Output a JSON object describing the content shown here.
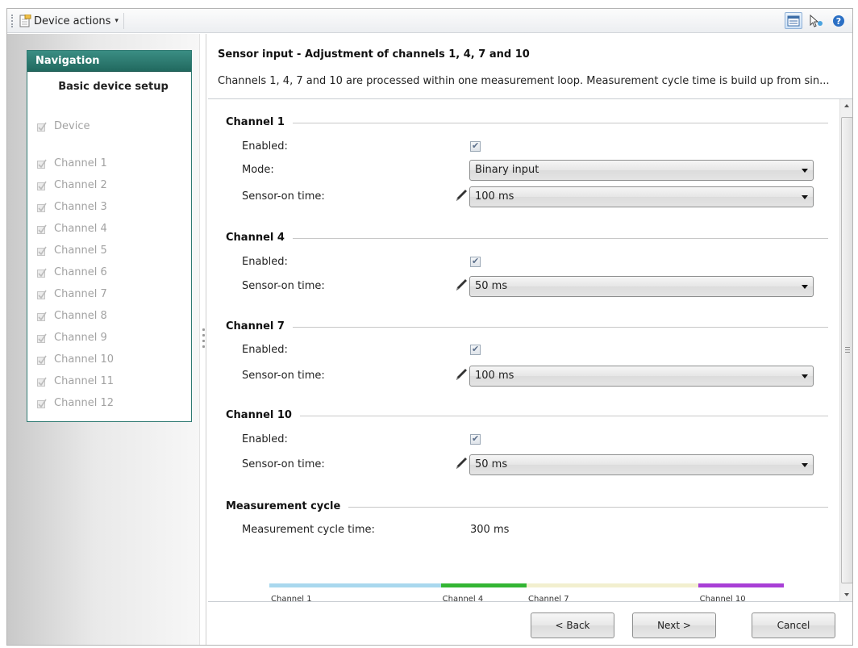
{
  "toolbar": {
    "device_actions_label": "Device actions",
    "icons": [
      "grip-icon",
      "document-icon",
      "dropdown-caret-icon",
      "layout-view-icon",
      "pointer-help-icon",
      "help-icon"
    ]
  },
  "navigation": {
    "header": "Navigation",
    "title": "Basic device setup",
    "items": [
      {
        "label": "Device"
      },
      {
        "label": "Channel 1"
      },
      {
        "label": "Channel 2"
      },
      {
        "label": "Channel 3"
      },
      {
        "label": "Channel 4"
      },
      {
        "label": "Channel 5"
      },
      {
        "label": "Channel 6"
      },
      {
        "label": "Channel 7"
      },
      {
        "label": "Channel 8"
      },
      {
        "label": "Channel 9"
      },
      {
        "label": "Channel 10"
      },
      {
        "label": "Channel 11"
      },
      {
        "label": "Channel 12"
      }
    ]
  },
  "page": {
    "title": "Sensor input - Adjustment of channels 1, 4, 7 and 10",
    "description": "Channels 1, 4, 7 and 10 are processed within one measurement loop. Measurement cycle time is build up from sin..."
  },
  "sections": [
    {
      "title": "Channel 1",
      "enabled_label": "Enabled:",
      "enabled": true,
      "mode_label": "Mode:",
      "mode_value": "Binary input",
      "sensor_label": "Sensor-on time:",
      "sensor_value": "100 ms"
    },
    {
      "title": "Channel 4",
      "enabled_label": "Enabled:",
      "enabled": true,
      "sensor_label": "Sensor-on time:",
      "sensor_value": "50 ms"
    },
    {
      "title": "Channel 7",
      "enabled_label": "Enabled:",
      "enabled": true,
      "sensor_label": "Sensor-on time:",
      "sensor_value": "100 ms"
    },
    {
      "title": "Channel 10",
      "enabled_label": "Enabled:",
      "enabled": true,
      "sensor_label": "Sensor-on time:",
      "sensor_value": "50 ms"
    }
  ],
  "measurement": {
    "title": "Measurement cycle",
    "time_label": "Measurement cycle time:",
    "time_value": "300 ms",
    "timeline": [
      {
        "label": "Channel 1",
        "ms": 100,
        "color": "#a9d8ee"
      },
      {
        "label": "Channel 4",
        "ms": 50,
        "color": "#33b533"
      },
      {
        "label": "Channel 7",
        "ms": 100,
        "color": "#f2efcf"
      },
      {
        "label": "Channel 10",
        "ms": 50,
        "color": "#a83fd6"
      }
    ]
  },
  "buttons": {
    "back": "< Back",
    "next": "Next >",
    "cancel": "Cancel"
  },
  "colors": {
    "nav_header": "#2b7d73",
    "accent_border": "#2f7a72"
  }
}
